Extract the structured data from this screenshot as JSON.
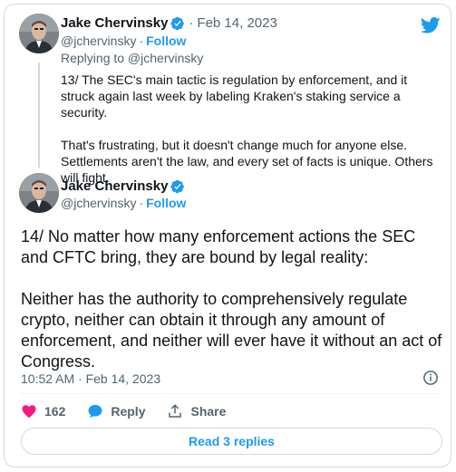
{
  "quoted_tweet": {
    "author_name": "Jake Chervinsky",
    "date": "Feb 14, 2023",
    "handle": "@jchervinsky",
    "follow_label": "Follow",
    "replying_to": "Replying to @jchervinsky",
    "paragraphs": [
      "13/ The SEC's main tactic is regulation by enforcement, and it struck again last week by labeling Kraken's staking service a security.",
      "That's frustrating, but it doesn't change much for anyone else. Settlements aren't the law, and every set of facts is unique. Others will fight."
    ]
  },
  "main_tweet": {
    "author_name": "Jake Chervinsky",
    "handle": "@jchervinsky",
    "follow_label": "Follow",
    "paragraphs": [
      "14/ No matter how many enforcement actions the SEC and CFTC bring, they are bound by legal reality:",
      "Neither has the authority to comprehensively regulate crypto, neither can obtain it through any amount of enforcement, and neither will ever have it without an act of Congress."
    ],
    "timestamp": "10:52 AM · Feb 14, 2023"
  },
  "actions": {
    "like_count": "162",
    "reply_label": "Reply",
    "share_label": "Share"
  },
  "read_replies_label": "Read 3 replies",
  "separator": "·",
  "colors": {
    "accent": "#1d9bf0",
    "like": "#f91880",
    "secondary_text": "#536471",
    "border": "#cfd9de"
  },
  "icons": [
    "twitter-bird-icon",
    "verified-badge-icon",
    "heart-icon",
    "reply-bubble-icon",
    "share-icon",
    "info-icon"
  ]
}
